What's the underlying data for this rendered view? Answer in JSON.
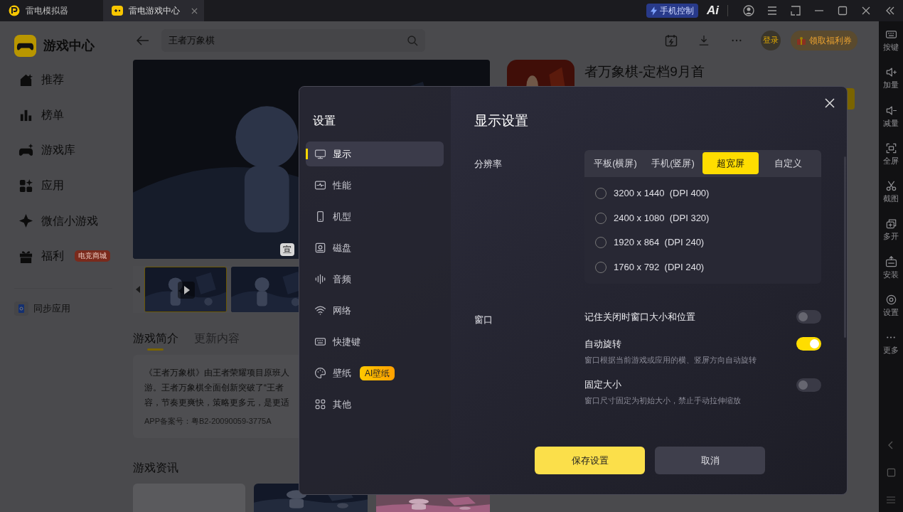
{
  "title_bar": {
    "tabs": [
      {
        "label": "雷电模拟器",
        "selected": false
      },
      {
        "label": "雷电游戏中心",
        "selected": true
      }
    ],
    "phone_control": "手机控制",
    "ai_logo": "Ai"
  },
  "sidebar": {
    "title": "游戏中心",
    "items": [
      {
        "label": "推荐"
      },
      {
        "label": "榜单"
      },
      {
        "label": "游戏库"
      },
      {
        "label": "应用"
      },
      {
        "label": "微信小游戏"
      },
      {
        "label": "福利",
        "badge": "电竞商城"
      }
    ],
    "sync": "同步应用"
  },
  "search": {
    "value": "王者万象棋"
  },
  "header": {
    "login": "登录",
    "coupon": "领取福利券"
  },
  "game": {
    "title": "者万象棋-定档9月首",
    "video_tag": "宣"
  },
  "detail_tabs": [
    {
      "label": "游戏简介",
      "selected": true
    },
    {
      "label": "更新内容",
      "selected": false
    }
  ],
  "description": {
    "lines": [
      "《王者万象棋》由王者荣耀项目原班人",
      "游。王者万象棋全面创新突破了“王者",
      "容，节奏更爽快，策略更多元，是更适"
    ],
    "record": "APP备案号：粤B2-20090059-3775A"
  },
  "news": {
    "title": "游戏资讯"
  },
  "right_toolbar": {
    "items": [
      "按键",
      "加量",
      "减量",
      "全屏",
      "截图",
      "多开",
      "安装",
      "设置",
      "更多"
    ]
  },
  "dialog": {
    "title": "设置",
    "heading": "显示设置",
    "nav": [
      {
        "label": "显示",
        "selected": true
      },
      {
        "label": "性能",
        "selected": false
      },
      {
        "label": "机型",
        "selected": false
      },
      {
        "label": "磁盘",
        "selected": false
      },
      {
        "label": "音频",
        "selected": false
      },
      {
        "label": "网络",
        "selected": false
      },
      {
        "label": "快捷键",
        "selected": false
      },
      {
        "label": "壁纸",
        "selected": false,
        "badge": "AI壁纸"
      },
      {
        "label": "其他",
        "selected": false
      }
    ],
    "resolution": {
      "label": "分辨率",
      "tabs": [
        {
          "label": "平板(横屏)",
          "selected": false
        },
        {
          "label": "手机(竖屏)",
          "selected": false
        },
        {
          "label": "超宽屏",
          "selected": true
        },
        {
          "label": "自定义",
          "selected": false
        }
      ],
      "options": [
        {
          "label": "3200 x 1440  (DPI 400)",
          "selected": false
        },
        {
          "label": "2400 x 1080  (DPI 320)",
          "selected": false
        },
        {
          "label": "1920 x 864  (DPI 240)",
          "selected": false
        },
        {
          "label": "1760 x 792  (DPI 240)",
          "selected": false
        }
      ]
    },
    "window": {
      "label": "窗口",
      "toggles": [
        {
          "label": "记住关闭时窗口大小和位置",
          "on": false
        },
        {
          "label": "自动旋转",
          "on": true,
          "description": "窗口根据当前游戏或应用的横、竖屏方向自动旋转"
        },
        {
          "label": "固定大小",
          "on": false,
          "description": "窗口尺寸固定为初始大小，禁止手动拉伸缩放"
        }
      ]
    },
    "buttons": {
      "save": "保存设置",
      "cancel": "取消"
    }
  }
}
